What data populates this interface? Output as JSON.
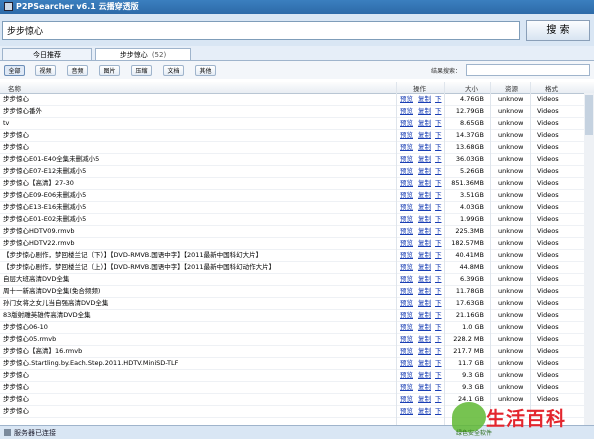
{
  "window": {
    "title": "P2PSearcher v6.1 云播穿透版"
  },
  "search": {
    "value": "步步惊心",
    "button": "搜 索"
  },
  "tabs": [
    {
      "label": "今日推荐"
    },
    {
      "label": "步步惊心",
      "count": "(52)"
    }
  ],
  "filters": {
    "buttons": [
      "全部",
      "视频",
      "音频",
      "图片",
      "压缩",
      "文档",
      "其他"
    ],
    "result_search_label": "结果搜索："
  },
  "table": {
    "headers": {
      "name": "名称",
      "ops": "操作",
      "size": "大小",
      "source": "资源",
      "format": "格式"
    },
    "actions": {
      "play": "预览",
      "copy": "复制",
      "download": "下"
    },
    "rows": [
      {
        "name": "步步惊心",
        "size": "4.76GB",
        "source": "unknow",
        "format": "Videos"
      },
      {
        "name": "步步惊心番外",
        "size": "12.79GB",
        "source": "unknow",
        "format": "Videos"
      },
      {
        "name": "tv",
        "size": "8.65GB",
        "source": "unknow",
        "format": "Videos"
      },
      {
        "name": "步步惊心",
        "size": "14.37GB",
        "source": "unknow",
        "format": "Videos"
      },
      {
        "name": "步步惊心",
        "size": "13.68GB",
        "source": "unknow",
        "format": "Videos"
      },
      {
        "name": "步步惊心E01-E40全集未删减小5",
        "size": "36.03GB",
        "source": "unknow",
        "format": "Videos"
      },
      {
        "name": "步步惊心E07-E12未删减小5",
        "size": "5.26GB",
        "source": "unknow",
        "format": "Videos"
      },
      {
        "name": "步步惊心【高清】27-30",
        "size": "851.36MB",
        "source": "unknow",
        "format": "Videos"
      },
      {
        "name": "步步惊心E09-E06未删减小5",
        "size": "3.51GB",
        "source": "unknow",
        "format": "Videos"
      },
      {
        "name": "步步惊心E13-E16未删减小5",
        "size": "4.03GB",
        "source": "unknow",
        "format": "Videos"
      },
      {
        "name": "步步惊心E01-E02未删减小5",
        "size": "1.99GB",
        "source": "unknow",
        "format": "Videos"
      },
      {
        "name": "步步惊心HDTV09.rmvb",
        "size": "225.3MB",
        "source": "unknow",
        "format": "Videos"
      },
      {
        "name": "步步惊心HDTV22.rmvb",
        "size": "182.57MB",
        "source": "unknow",
        "format": "Videos"
      },
      {
        "name": "【步步惊心剧作，梦回楼兰记（下）】【DVD-RMVB.国语中字】【2011最新中国科幻大片】",
        "size": "40.41MB",
        "source": "unknow",
        "format": "Videos"
      },
      {
        "name": "【步步惊心剧作，梦回楼兰记（上）】【DVD-RMVB.国语中字】【2011最新中国科幻动作大片】",
        "size": "44.8MB",
        "source": "unknow",
        "format": "Videos"
      },
      {
        "name": "自层大班高清DVD全集",
        "size": "6.39GB",
        "source": "unknow",
        "format": "Videos"
      },
      {
        "name": "周十一新高清DVD全集(免合频频)",
        "size": "11.78GB",
        "source": "unknow",
        "format": "Videos"
      },
      {
        "name": "孙门女将之女儿当自强高清DVD全集",
        "size": "17.63GB",
        "source": "unknow",
        "format": "Videos"
      },
      {
        "name": "83版射雕英雄传高清DVD全集",
        "size": "21.16GB",
        "source": "unknow",
        "format": "Videos"
      },
      {
        "name": "步步惊心06-10",
        "size": "1.0 GB",
        "source": "unknow",
        "format": "Videos"
      },
      {
        "name": "步步惊心05.rmvb",
        "size": "228.2 MB",
        "source": "unknow",
        "format": "Videos"
      },
      {
        "name": "步步惊心【高清】16.rmvb",
        "size": "217.7 MB",
        "source": "unknow",
        "format": "Videos"
      },
      {
        "name": "步步惊心.Startling.by.Each.Step.2011.HDTV.MiniSD-TLF",
        "size": "11.7 GB",
        "source": "unknow",
        "format": "Videos"
      },
      {
        "name": "步步惊心",
        "size": "9.3 GB",
        "source": "unknow",
        "format": "Videos"
      },
      {
        "name": "步步惊心",
        "size": "9.3 GB",
        "source": "unknow",
        "format": "Videos"
      },
      {
        "name": "步步惊心",
        "size": "24.1 GB",
        "source": "unknow",
        "format": "Videos"
      },
      {
        "name": "步步惊心",
        "size": "",
        "source": "",
        "format": ""
      }
    ]
  },
  "status": {
    "text": "服务器已连接"
  },
  "watermark": {
    "text": "生活百科",
    "sub": "绿色安全软件"
  }
}
